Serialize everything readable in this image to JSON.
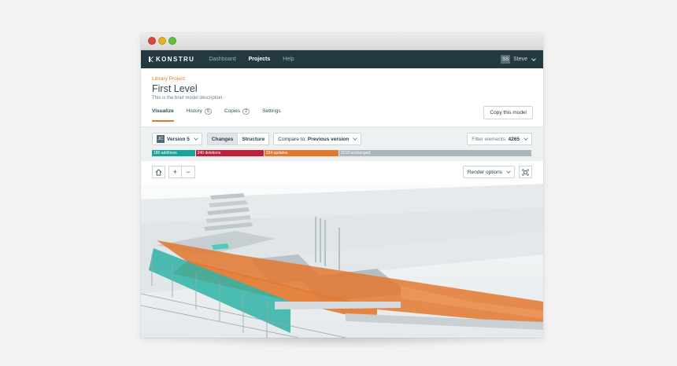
{
  "app": {
    "brand": "KONSTRU",
    "nav": [
      "Dashboard",
      "Projects",
      "Help"
    ],
    "active_nav": "Projects",
    "user": {
      "initials": "SS",
      "name": "Steve"
    }
  },
  "header": {
    "breadcrumb": "Library Project",
    "title": "First Level",
    "description": "This is the brief model description.",
    "copy_button": "Copy this model"
  },
  "tabs": [
    {
      "label": "Visualize"
    },
    {
      "label": "History",
      "count": "5"
    },
    {
      "label": "Copies",
      "count": "2"
    },
    {
      "label": "Settings"
    }
  ],
  "toolbar": {
    "version_initials": "JC",
    "version_label": "Version 5",
    "view_changes": "Changes",
    "view_structure": "Structure",
    "compare_prefix": "Compare to:",
    "compare_value": "Previous version",
    "filter_prefix": "Filter elements:",
    "filter_count": "4265"
  },
  "changes": [
    {
      "label": "180 additions",
      "value": 180,
      "color": "#1aa39a"
    },
    {
      "label": "240 deletions",
      "value": 240,
      "color": "#c0213a"
    },
    {
      "label": "324 updates",
      "value": 324,
      "color": "#e3782f"
    },
    {
      "label": "3210 unchanged",
      "value": 3210,
      "color": "#a9b6bb"
    }
  ],
  "viewport": {
    "render_options": "Render options",
    "colors": {
      "unchanged": "#cfd6d9",
      "updated": "#e3782f",
      "added": "#2fb3a6",
      "sky": "#f5f7f8"
    }
  }
}
